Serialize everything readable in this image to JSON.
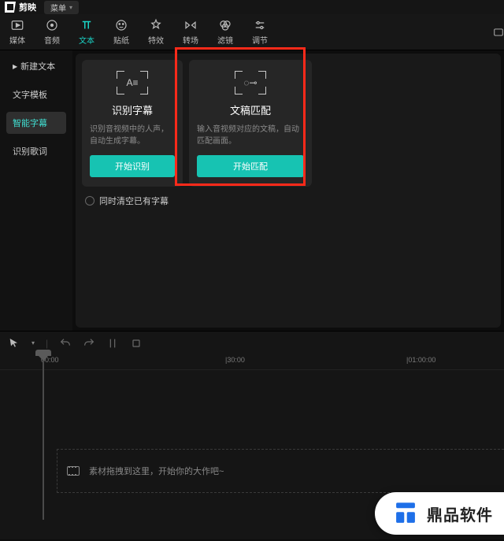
{
  "app": {
    "title": "剪映",
    "menu_label": "菜单"
  },
  "toolbar": {
    "tabs": [
      {
        "label": "媒体"
      },
      {
        "label": "音频"
      },
      {
        "label": "文本"
      },
      {
        "label": "贴纸"
      },
      {
        "label": "特效"
      },
      {
        "label": "转场"
      },
      {
        "label": "滤镜"
      },
      {
        "label": "调节"
      }
    ]
  },
  "sidebar": {
    "items": [
      {
        "label": "新建文本"
      },
      {
        "label": "文字模板"
      },
      {
        "label": "智能字幕"
      },
      {
        "label": "识别歌词"
      }
    ]
  },
  "cards": {
    "subtitle": {
      "title": "识别字幕",
      "desc": "识别音视频中的人声，自动生成字幕。",
      "button": "开始识别"
    },
    "match": {
      "title": "文稿匹配",
      "desc": "输入音视频对应的文稿，自动匹配画面。",
      "button": "开始匹配"
    },
    "clear_label": "同时清空已有字幕"
  },
  "timeline": {
    "marks": [
      "00:00",
      "|30:00",
      "|01:00:00"
    ],
    "placeholder": "素材拖拽到这里，开始你的大作吧~"
  },
  "watermark": {
    "text": "鼎品软件"
  }
}
